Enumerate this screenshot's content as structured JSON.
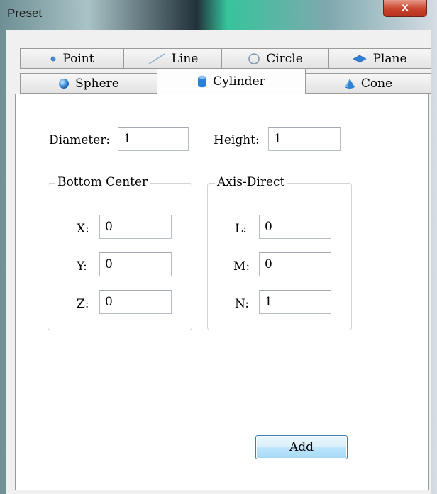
{
  "window": {
    "title": "Preset",
    "close_label": "x"
  },
  "tabs": {
    "row1": [
      {
        "label": "Point",
        "icon": "point-icon"
      },
      {
        "label": "Line",
        "icon": "line-icon"
      },
      {
        "label": "Circle",
        "icon": "circle-icon"
      },
      {
        "label": "Plane",
        "icon": "plane-icon"
      }
    ],
    "row2": [
      {
        "label": "Sphere",
        "icon": "sphere-icon"
      },
      {
        "label": "Cylinder",
        "icon": "cylinder-icon",
        "selected": true
      },
      {
        "label": "Cone",
        "icon": "cone-icon"
      }
    ]
  },
  "form": {
    "diameter_label": "Diameter:",
    "diameter_value": "1",
    "height_label": "Height:",
    "height_value": "1",
    "bottom_center": {
      "title": "Bottom Center",
      "x_label": "X:",
      "x_value": "0",
      "y_label": "Y:",
      "y_value": "0",
      "z_label": "Z:",
      "z_value": "0"
    },
    "axis_direct": {
      "title": "Axis-Direct",
      "l_label": "L:",
      "l_value": "0",
      "m_label": "M:",
      "m_value": "0",
      "n_label": "N:",
      "n_value": "1"
    },
    "add_label": "Add"
  },
  "colors": {
    "icon_blue": "#2f7fd3",
    "button_border": "#3c7fb1",
    "close_red": "#c9442e"
  }
}
